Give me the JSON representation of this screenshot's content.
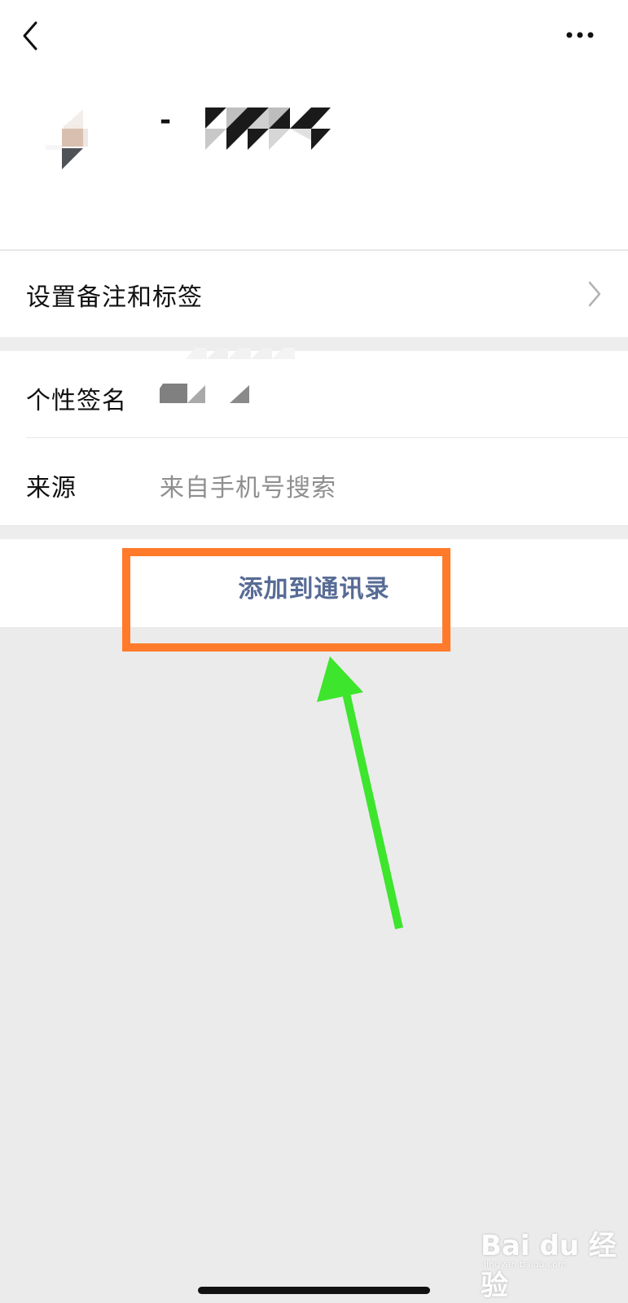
{
  "header": {
    "back_icon": "chevron-left-icon",
    "more_icon": "ellipsis-icon",
    "name_dash": "-"
  },
  "rows": {
    "remark_label": "设置备注和标签",
    "remark_chevron_icon": "chevron-right-icon",
    "signature_label": "个性签名",
    "source_label": "来源",
    "source_value": "来自手机号搜索"
  },
  "action": {
    "add_label": "添加到通讯录"
  },
  "annotation": {
    "box_color": "#ff7a2a",
    "arrow_color": "#3de52c"
  },
  "watermark": {
    "main": "Bai du 经验",
    "sub": "jingyan.baidu.com"
  },
  "colors": {
    "link": "#576b95",
    "background": "#ebebeb"
  }
}
